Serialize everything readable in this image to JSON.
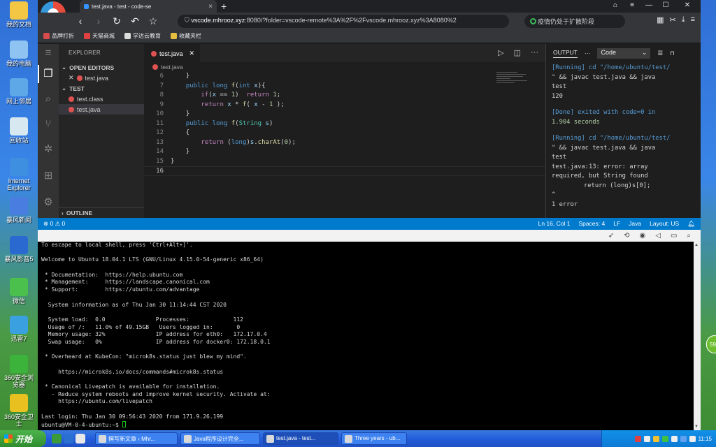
{
  "desktop": {
    "icons": [
      {
        "label": "我的文档",
        "color": "#f3c744"
      },
      {
        "label": "我的电脑",
        "color": "#8fc3f2"
      },
      {
        "label": "网上邻居",
        "color": "#5fa8e8"
      },
      {
        "label": "回收站",
        "color": "#d8e8f0"
      },
      {
        "label": "Internet Explorer",
        "color": "#3e8fe0"
      },
      {
        "label": "暴风新闻",
        "color": "#4a7de0"
      },
      {
        "label": "暴风影音5",
        "color": "#2a6ad0"
      },
      {
        "label": "微信",
        "color": "#4cc04c"
      },
      {
        "label": "迅雷7",
        "color": "#3aa0e0"
      },
      {
        "label": "360安全浏览器",
        "color": "#3cb43c"
      },
      {
        "label": "360安全卫士",
        "color": "#e8c020"
      }
    ]
  },
  "browser": {
    "tab_title": "test.java - test - code-se",
    "new_tab": "+",
    "url_host": "vscode.mhrooz.xyz",
    "url_rest": ":8080/?folder=vscode-remote%3A%2F%2Fvscode.mhrooz.xyz%3A8080%2",
    "search_text": "疫情仍处于扩散阶段",
    "bookmarks": [
      "品牌打折",
      "天猫商城",
      "学达云教育",
      "收藏夹栏"
    ]
  },
  "sidebar": {
    "title": "EXPLORER",
    "open_editors": "OPEN EDITORS",
    "open_file": "test.java",
    "folder": "TEST",
    "files": [
      "test.class",
      "test.java"
    ],
    "outline": "OUTLINE"
  },
  "editor": {
    "tab": "test.java",
    "breadcrumb": "test.java",
    "lines": [
      {
        "n": "6",
        "html": "    <span class='pl'>}</span>"
      },
      {
        "n": "7",
        "html": "    <span class='kw'>public</span> <span class='kw'>long</span> <span class='fn'>f</span><span class='pl'>(</span><span class='kw'>int</span> <span class='vr'>x</span><span class='pl'>){</span>"
      },
      {
        "n": "8",
        "html": "        <span class='ctl'>if</span><span class='pl'>(</span><span class='vr'>x</span> <span class='pl'>==</span> <span class='nm'>1</span><span class='pl'>)</span>  <span class='ctl'>return</span> <span class='nm'>1</span><span class='pl'>;</span>"
      },
      {
        "n": "9",
        "html": "        <span class='ctl'>return</span> <span class='vr'>x</span> <span class='pl'>*</span> <span class='fn'>f</span><span class='pl'>(</span> <span class='vr'>x</span> <span class='pl'>-</span> <span class='nm'>1</span> <span class='pl'>);</span>"
      },
      {
        "n": "10",
        "html": "    <span class='pl'>}</span>"
      },
      {
        "n": "11",
        "html": "    <span class='kw'>public</span> <span class='kw'>long</span> <span class='fn'>f</span><span class='pl'>(</span><span class='ty'>String</span> <span class='vr'>s</span><span class='pl'>)</span>"
      },
      {
        "n": "12",
        "html": "    <span class='pl'>{</span>"
      },
      {
        "n": "13",
        "html": "        <span class='ctl'>return</span> <span class='pl'>(</span><span class='kw'>long</span><span class='pl'>)</span><span class='vr'>s</span><span class='pl'>.</span><span class='fn'>charAt</span><span class='pl'>(</span><span class='nm'>0</span><span class='pl'>);</span>"
      },
      {
        "n": "14",
        "html": "    <span class='pl'>}</span>"
      },
      {
        "n": "15",
        "html": "<span class='pl'>}</span>"
      },
      {
        "n": "16",
        "html": ""
      }
    ]
  },
  "output": {
    "tab": "OUTPUT",
    "select": "Code",
    "lines": [
      {
        "cls": "blue",
        "text": "[Running] cd \"/home/ubuntu/test/"
      },
      {
        "cls": "",
        "text": "\" && javac test.java && java"
      },
      {
        "cls": "",
        "text": "test"
      },
      {
        "cls": "",
        "text": "120"
      },
      {
        "cls": "gap",
        "text": ""
      },
      {
        "cls": "blue",
        "text": "[Done] exited with code=0 in"
      },
      {
        "cls": "num",
        "text": "1.904 seconds"
      },
      {
        "cls": "gap",
        "text": ""
      },
      {
        "cls": "blue",
        "text": "[Running] cd \"/home/ubuntu/test/"
      },
      {
        "cls": "",
        "text": "\" && javac test.java && java"
      },
      {
        "cls": "",
        "text": "test"
      },
      {
        "cls": "",
        "text": "test.java:13: error: array"
      },
      {
        "cls": "",
        "text": "required, but String found"
      },
      {
        "cls": "indent",
        "text": "return (long)s[0];"
      },
      {
        "cls": "",
        "text": "                        ^"
      },
      {
        "cls": "",
        "text": "1 error"
      }
    ]
  },
  "statusbar": {
    "problems": "⊗ 0 ⚠ 0",
    "position": "Ln 16, Col 1",
    "spaces": "Spaces: 4",
    "eol": "LF",
    "language": "Java",
    "layout": "Layout: US"
  },
  "terminal": {
    "lines": [
      "To escape to local shell, press 'Ctrl+Alt+]'.",
      "",
      "Welcome to Ubuntu 18.04.1 LTS (GNU/Linux 4.15.0-54-generic x86_64)",
      "",
      " * Documentation:  https://help.ubuntu.com",
      " * Management:     https://landscape.canonical.com",
      " * Support:        https://ubuntu.com/advantage",
      "",
      "  System information as of Thu Jan 30 11:14:44 CST 2020",
      "",
      "  System load:  0.0               Processes:             112",
      "  Usage of /:   11.0% of 49.15GB   Users logged in:       0",
      "  Memory usage: 32%               IP address for eth0:   172.17.0.4",
      "  Swap usage:   0%                IP address for docker0: 172.18.0.1",
      "",
      " * Overheard at KubeCon: \"microk8s.status just blew my mind\".",
      "",
      "     https://microk8s.io/docs/commands#microk8s.status",
      "",
      " * Canonical Livepatch is available for installation.",
      "   - Reduce system reboots and improve kernel security. Activate at:",
      "     https://ubuntu.com/livepatch",
      "",
      "Last login: Thu Jan 30 09:56:43 2020 from 171.9.26.199"
    ],
    "prompt": "ubuntu@VM-0-4-ubuntu:~$ "
  },
  "side_badge": "59",
  "taskbar": {
    "start": "开始",
    "tasks": [
      "撰写新文章 ‹ Mhr...",
      "Java程序设计完全...",
      "test.java - test...",
      "Three years - ub..."
    ],
    "clock": "11:15"
  }
}
